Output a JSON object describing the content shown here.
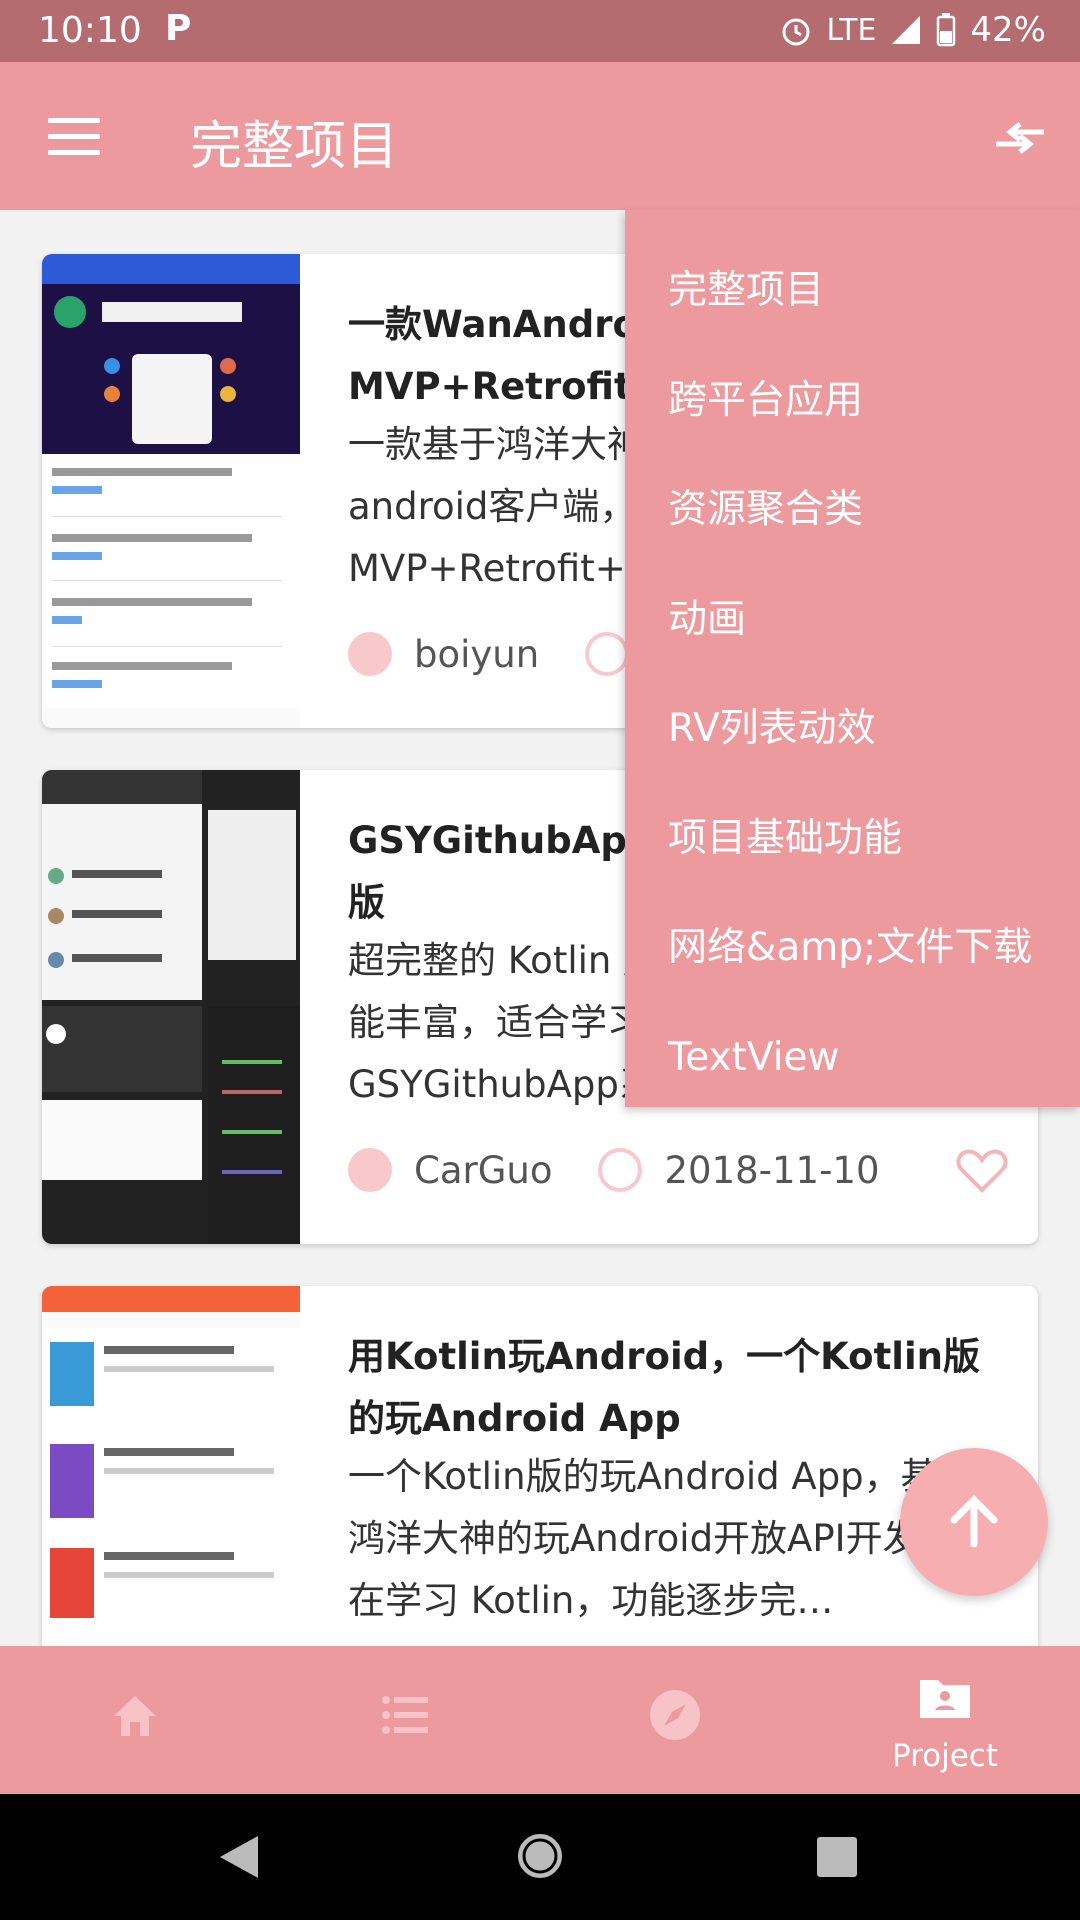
{
  "status_bar": {
    "time": "10:10",
    "network": "LTE",
    "battery": "42%"
  },
  "app_bar": {
    "title": "完整项目"
  },
  "projects": [
    {
      "title": "一款WanAndroid客户端，采用MVP+Retrofit+RxJava+Glide",
      "description": "一款基于鸿洋大神的玩Android Api的android客户端，项目使用 MVP+Retrofit+RxJava+Glide",
      "author": "boiyun",
      "date": ""
    },
    {
      "title": "GSYGithubApp Android Kotlin 版",
      "description": "超完整的 Kotlin 版 Github 客户端，功能丰富，适合学习和日常使用。GSYGithubApp系列，目前已经拥有…",
      "author": "CarGuo",
      "date": "2018-11-10"
    },
    {
      "title": "用Kotlin玩Android，一个Kotlin版的玩Android App",
      "description": "一个Kotlin版的玩Android App，基于鸿洋大神的玩Android开放API开发，旨在学习 Kotlin，功能逐步完…",
      "author": "",
      "date": ""
    }
  ],
  "dropdown": {
    "items": [
      "完整项目",
      "跨平台应用",
      "资源聚合类",
      "动画",
      "RV列表动效",
      "项目基础功能",
      "网络&amp;文件下载",
      "TextView"
    ]
  },
  "bottom_nav": {
    "tabs": [
      {
        "icon": "home-icon",
        "label": ""
      },
      {
        "icon": "list-icon",
        "label": ""
      },
      {
        "icon": "compass-icon",
        "label": ""
      },
      {
        "icon": "folder-user-icon",
        "label": "Project",
        "selected": true
      }
    ]
  },
  "colors": {
    "primary": "#ed9a9f",
    "status_bar": "#b46c71",
    "accent_light": "#f8c8cb",
    "fab": "#f7aeb1"
  }
}
